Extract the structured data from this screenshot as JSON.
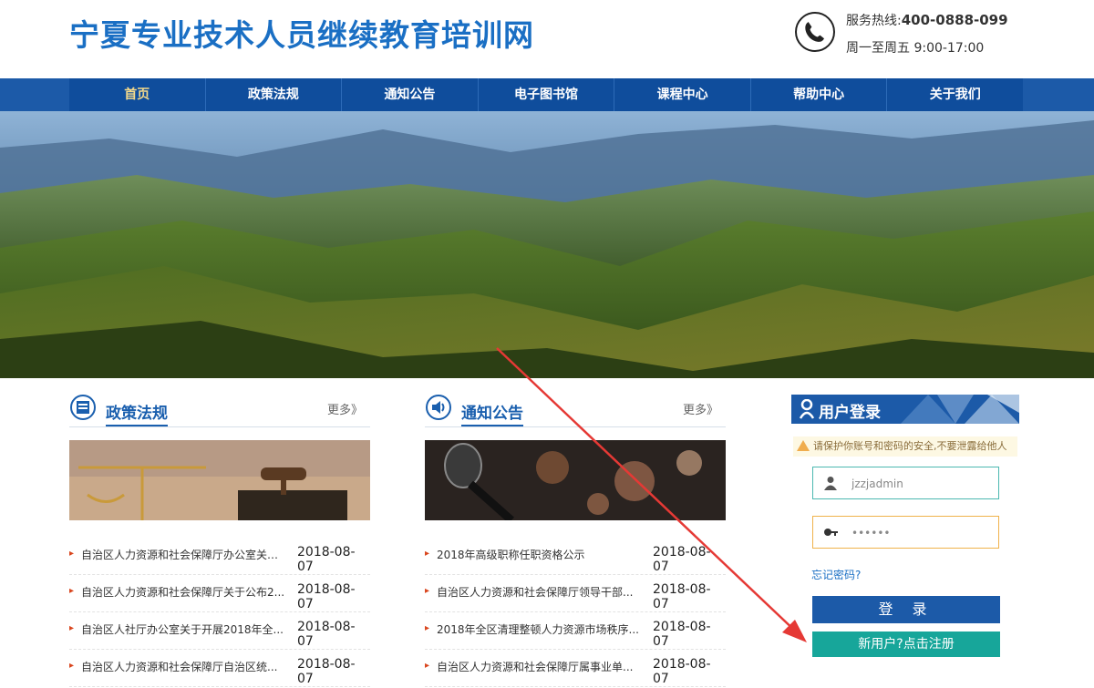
{
  "header": {
    "site_title": "宁夏专业技术人员继续教育培训网",
    "hotline_label": "服务热线:",
    "hotline_number": "400-0888-099",
    "hours": "周一至周五  9:00-17:00"
  },
  "nav": {
    "items": [
      {
        "label": "首页"
      },
      {
        "label": "政策法规"
      },
      {
        "label": "通知公告"
      },
      {
        "label": "电子图书馆"
      },
      {
        "label": "课程中心"
      },
      {
        "label": "帮助中心"
      },
      {
        "label": "关于我们"
      }
    ],
    "active_color": "#f3d98b"
  },
  "policy": {
    "title": "政策法规",
    "more": "更多》",
    "news": [
      {
        "title": "自治区人力资源和社会保障厅办公室关于...",
        "date": "2018-08-07"
      },
      {
        "title": "自治区人力资源和社会保障厅关于公布2...",
        "date": "2018-08-07"
      },
      {
        "title": "自治区人社厅办公室关于开展2018年全...",
        "date": "2018-08-07"
      },
      {
        "title": "自治区人力资源和社会保障厅自治区统...",
        "date": "2018-08-07"
      }
    ]
  },
  "notice": {
    "title": "通知公告",
    "more": "更多》",
    "news": [
      {
        "title": "2018年高级职称任职资格公示",
        "date": "2018-08-07"
      },
      {
        "title": "自治区人力资源和社会保障厅领导干部...",
        "date": "2018-08-07"
      },
      {
        "title": "2018年全区清理整顿人力资源市场秩序...",
        "date": "2018-08-07"
      },
      {
        "title": "自治区人力资源和社会保障厅属事业单...",
        "date": "2018-08-07"
      }
    ]
  },
  "login": {
    "title": "用户登录",
    "warning": "请保护你账号和密码的安全,不要泄露给他人",
    "username_value": "jzzjadmin",
    "password_value": "••••••",
    "forgot": "忘记密码?",
    "login_button": "登 录",
    "register_button": "新用户?点击注册"
  },
  "colors": {
    "brand_blue": "#1c5aa8",
    "title_blue": "#1a6fc4",
    "register_teal": "#17a69a",
    "annotation_red": "#e53935"
  },
  "icons": [
    "phone-icon",
    "document-icon",
    "speaker-icon",
    "user-icon",
    "key-icon",
    "warning-icon"
  ]
}
